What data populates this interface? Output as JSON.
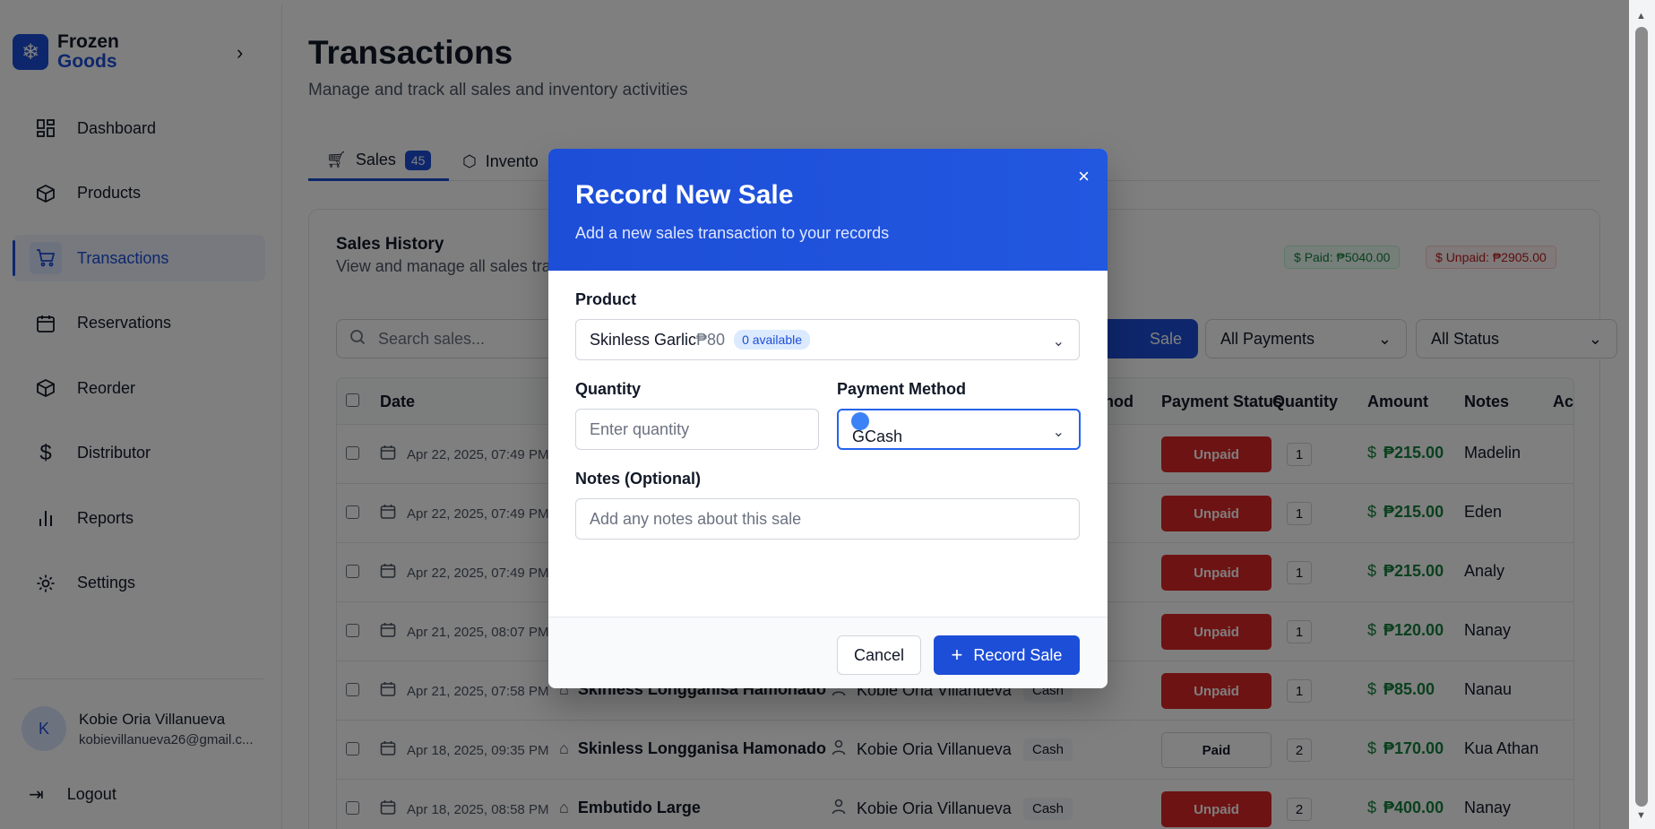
{
  "brand": {
    "line1": "Frozen",
    "line2": "Goods"
  },
  "sidebar": {
    "items": [
      {
        "label": "Dashboard",
        "icon": "layout-grid-icon"
      },
      {
        "label": "Products",
        "icon": "package-icon"
      },
      {
        "label": "Transactions",
        "icon": "cart-icon",
        "active": true
      },
      {
        "label": "Reservations",
        "icon": "calendar-icon"
      },
      {
        "label": "Reorder",
        "icon": "package-icon"
      },
      {
        "label": "Distributor",
        "icon": "dollar-icon"
      },
      {
        "label": "Reports",
        "icon": "bar-chart-icon"
      },
      {
        "label": "Settings",
        "icon": "gear-icon"
      }
    ],
    "user": {
      "initial": "K",
      "name": "Kobie Oria Villanueva",
      "email": "kobievillanueva26@gmail.c..."
    },
    "logout": "Logout"
  },
  "page": {
    "title": "Transactions",
    "subtitle": "Manage and track all sales and inventory activities",
    "tabs": [
      {
        "label": "Sales",
        "count": "45"
      },
      {
        "label": "Invento"
      }
    ]
  },
  "sales": {
    "title": "Sales History",
    "subtitle": "View and manage all sales tran",
    "paid_label": "Paid: ₱5040.00",
    "unpaid_label": "Unpaid: ₱2905.00",
    "search_placeholder": "Search sales...",
    "add_button": "Sale",
    "filter_payments": "All Payments",
    "filter_status": "All Status",
    "columns": {
      "date": "Date",
      "method": "ethod",
      "payment_status": "Payment Status",
      "quantity": "Quantity",
      "amount": "Amount",
      "notes": "Notes",
      "actions": "Ac"
    },
    "rows": [
      {
        "date": "Apr 22, 2025, 07:49 PM",
        "product": "",
        "staff": "",
        "method": "",
        "status": "Unpaid",
        "qty": "1",
        "amount": "₱215.00",
        "note": "Madelin"
      },
      {
        "date": "Apr 22, 2025, 07:49 PM",
        "product": "",
        "staff": "",
        "method": "",
        "status": "Unpaid",
        "qty": "1",
        "amount": "₱215.00",
        "note": "Eden"
      },
      {
        "date": "Apr 22, 2025, 07:49 PM",
        "product": "",
        "staff": "",
        "method": "",
        "status": "Unpaid",
        "qty": "1",
        "amount": "₱215.00",
        "note": "Analy"
      },
      {
        "date": "Apr 21, 2025, 08:07 PM",
        "product": "",
        "staff": "",
        "method": "",
        "status": "Unpaid",
        "qty": "1",
        "amount": "₱120.00",
        "note": "Nanay"
      },
      {
        "date": "Apr 21, 2025, 07:58 PM",
        "product": "Skinless Longganisa Hamonado",
        "staff": "Kobie Oria Villanueva",
        "method": "Cash",
        "status": "Unpaid",
        "qty": "1",
        "amount": "₱85.00",
        "note": "Nanau"
      },
      {
        "date": "Apr 18, 2025, 09:35 PM",
        "product": "Skinless Longganisa Hamonado",
        "staff": "Kobie Oria Villanueva",
        "method": "Cash",
        "status": "Paid",
        "qty": "2",
        "amount": "₱170.00",
        "note": "Kua Athan"
      },
      {
        "date": "Apr 18, 2025, 08:58 PM",
        "product": "Embutido Large",
        "staff": "Kobie Oria Villanueva",
        "method": "Cash",
        "status": "Unpaid",
        "qty": "2",
        "amount": "₱400.00",
        "note": "Nanay"
      }
    ]
  },
  "modal": {
    "title": "Record New Sale",
    "subtitle": "Add a new sales transaction to your records",
    "close": "×",
    "product_label": "Product",
    "product_name": "Skinless Garlic",
    "product_price": "₱80",
    "product_available": "0 available",
    "quantity_label": "Quantity",
    "quantity_placeholder": "Enter quantity",
    "payment_label": "Payment Method",
    "payment_value": "GCash",
    "notes_label": "Notes (Optional)",
    "notes_placeholder": "Add any notes about this sale",
    "cancel": "Cancel",
    "submit": "Record Sale"
  },
  "colors": {
    "accent": "#1d4ed8",
    "unpaid": "#dc2626",
    "paid_text": "#15803d"
  }
}
